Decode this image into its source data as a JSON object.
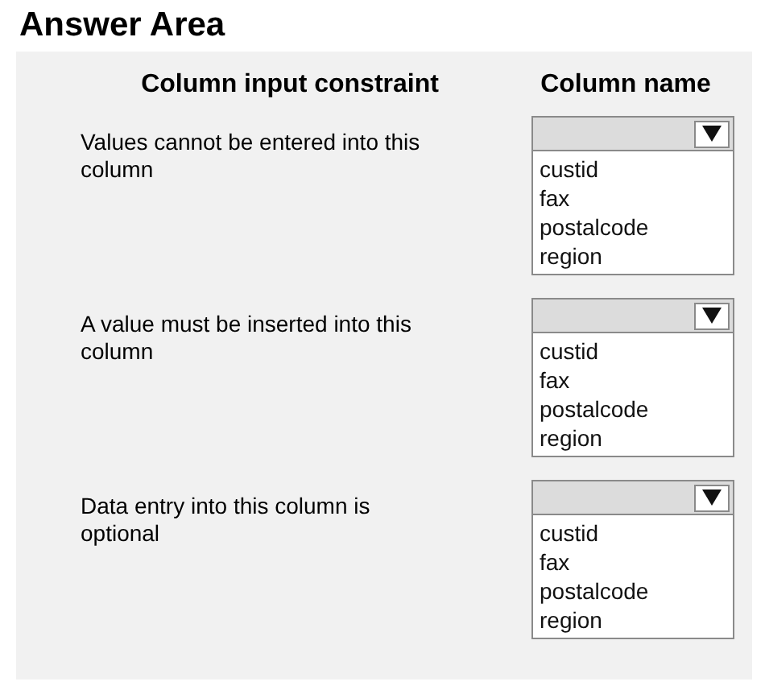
{
  "title": "Answer Area",
  "columns": [
    "Column input constraint",
    "Column name"
  ],
  "rows": [
    {
      "constraint": "Values cannot be entered into this column",
      "options": [
        "custid",
        "fax",
        "postalcode",
        "region"
      ]
    },
    {
      "constraint": "A value must be inserted into this column",
      "options": [
        "custid",
        "fax",
        "postalcode",
        "region"
      ]
    },
    {
      "constraint": "Data entry into this column is optional",
      "options": [
        "custid",
        "fax",
        "postalcode",
        "region"
      ]
    }
  ]
}
